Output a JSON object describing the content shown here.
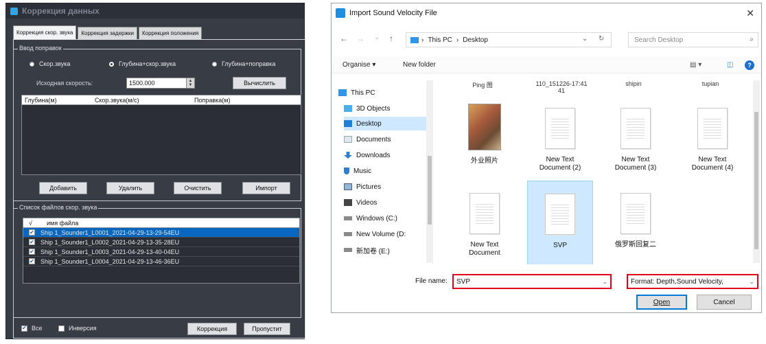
{
  "left_window": {
    "title": "Коррекция данных",
    "tabs": [
      "Коррекция скор. звука",
      "Коррекция задержки",
      "Коррекция положения"
    ],
    "group_input": {
      "title": "Ввод поправок",
      "radio_1": "Скор.звука",
      "radio_2": "Глубина+скор.звука",
      "radio_3": "Глубина+поправка",
      "initial_speed_label": "Исходная скорость:",
      "initial_speed_value": "1500.000",
      "calc_button": "Вычислить",
      "table_headers": [
        "Глубина(м)",
        "Скор.звука(м/с)",
        "Поправка(м)"
      ],
      "btn_add": "Добавить",
      "btn_delete": "Удалить",
      "btn_clear": "Очистить",
      "btn_import": "Импорт"
    },
    "group_files": {
      "title": "Список файлов скор. звука",
      "header_check": "√",
      "header_name": "имя файла",
      "files": [
        "Ship 1_Sounder1_L0001_2021-04-29-13-29-54EU",
        "Ship 1_Sounder1_L0002_2021-04-29-13-35-28EU",
        "Ship 1_Sounder1_L0003_2021-04-29-13-40-04EU",
        "Ship 1_Sounder1_L0004_2021-04-29-13-46-36EU"
      ]
    },
    "chk_all": "Все",
    "chk_invert": "Инверсия",
    "btn_correction": "Коррекция",
    "btn_skip": "Пропустит",
    "check_mark": "✔"
  },
  "right_window": {
    "title": "Import Sound Velocity File",
    "close": "✕",
    "nav": {
      "back": "←",
      "forward": "→",
      "down": "⌄",
      "up": "↑",
      "refresh": "↻",
      "chev": "⌄"
    },
    "address": {
      "part1": "This PC",
      "sep": "›",
      "part2": "Desktop"
    },
    "search_placeholder": "Search Desktop",
    "search_icon": "⌕",
    "toolbar": {
      "organise": "Organise ▾",
      "new_folder": "New folder",
      "view": "▤ ▾",
      "pane": "◫",
      "help": "?"
    },
    "sidebar": [
      "This PC",
      "3D Objects",
      "Desktop",
      "Documents",
      "Downloads",
      "Music",
      "Pictures",
      "Videos",
      "Windows (C:)",
      "New Volume (D:",
      "新加卷 (E:)"
    ],
    "cut_labels": [
      "Ping 图",
      "110_151226-17:41\n41",
      "shipin",
      "tupian"
    ],
    "files": [
      {
        "label": "外业照片",
        "kind": "photo"
      },
      {
        "label": "New Text\nDocument (2)",
        "kind": "doc"
      },
      {
        "label": "New Text\nDocument (3)",
        "kind": "doc"
      },
      {
        "label": "New Text\nDocument (4)",
        "kind": "doc"
      },
      {
        "label": "New Text\nDocument",
        "kind": "doc"
      },
      {
        "label": "SVP",
        "kind": "doc"
      },
      {
        "label": "俄罗斯回复二",
        "kind": "doc"
      }
    ],
    "filename_label": "File name:",
    "filename_value": "SVP",
    "format_value": "Format: Depth,Sound Velocity,",
    "dropdown": "⌄",
    "btn_open": "Open",
    "btn_cancel": "Cancel"
  }
}
